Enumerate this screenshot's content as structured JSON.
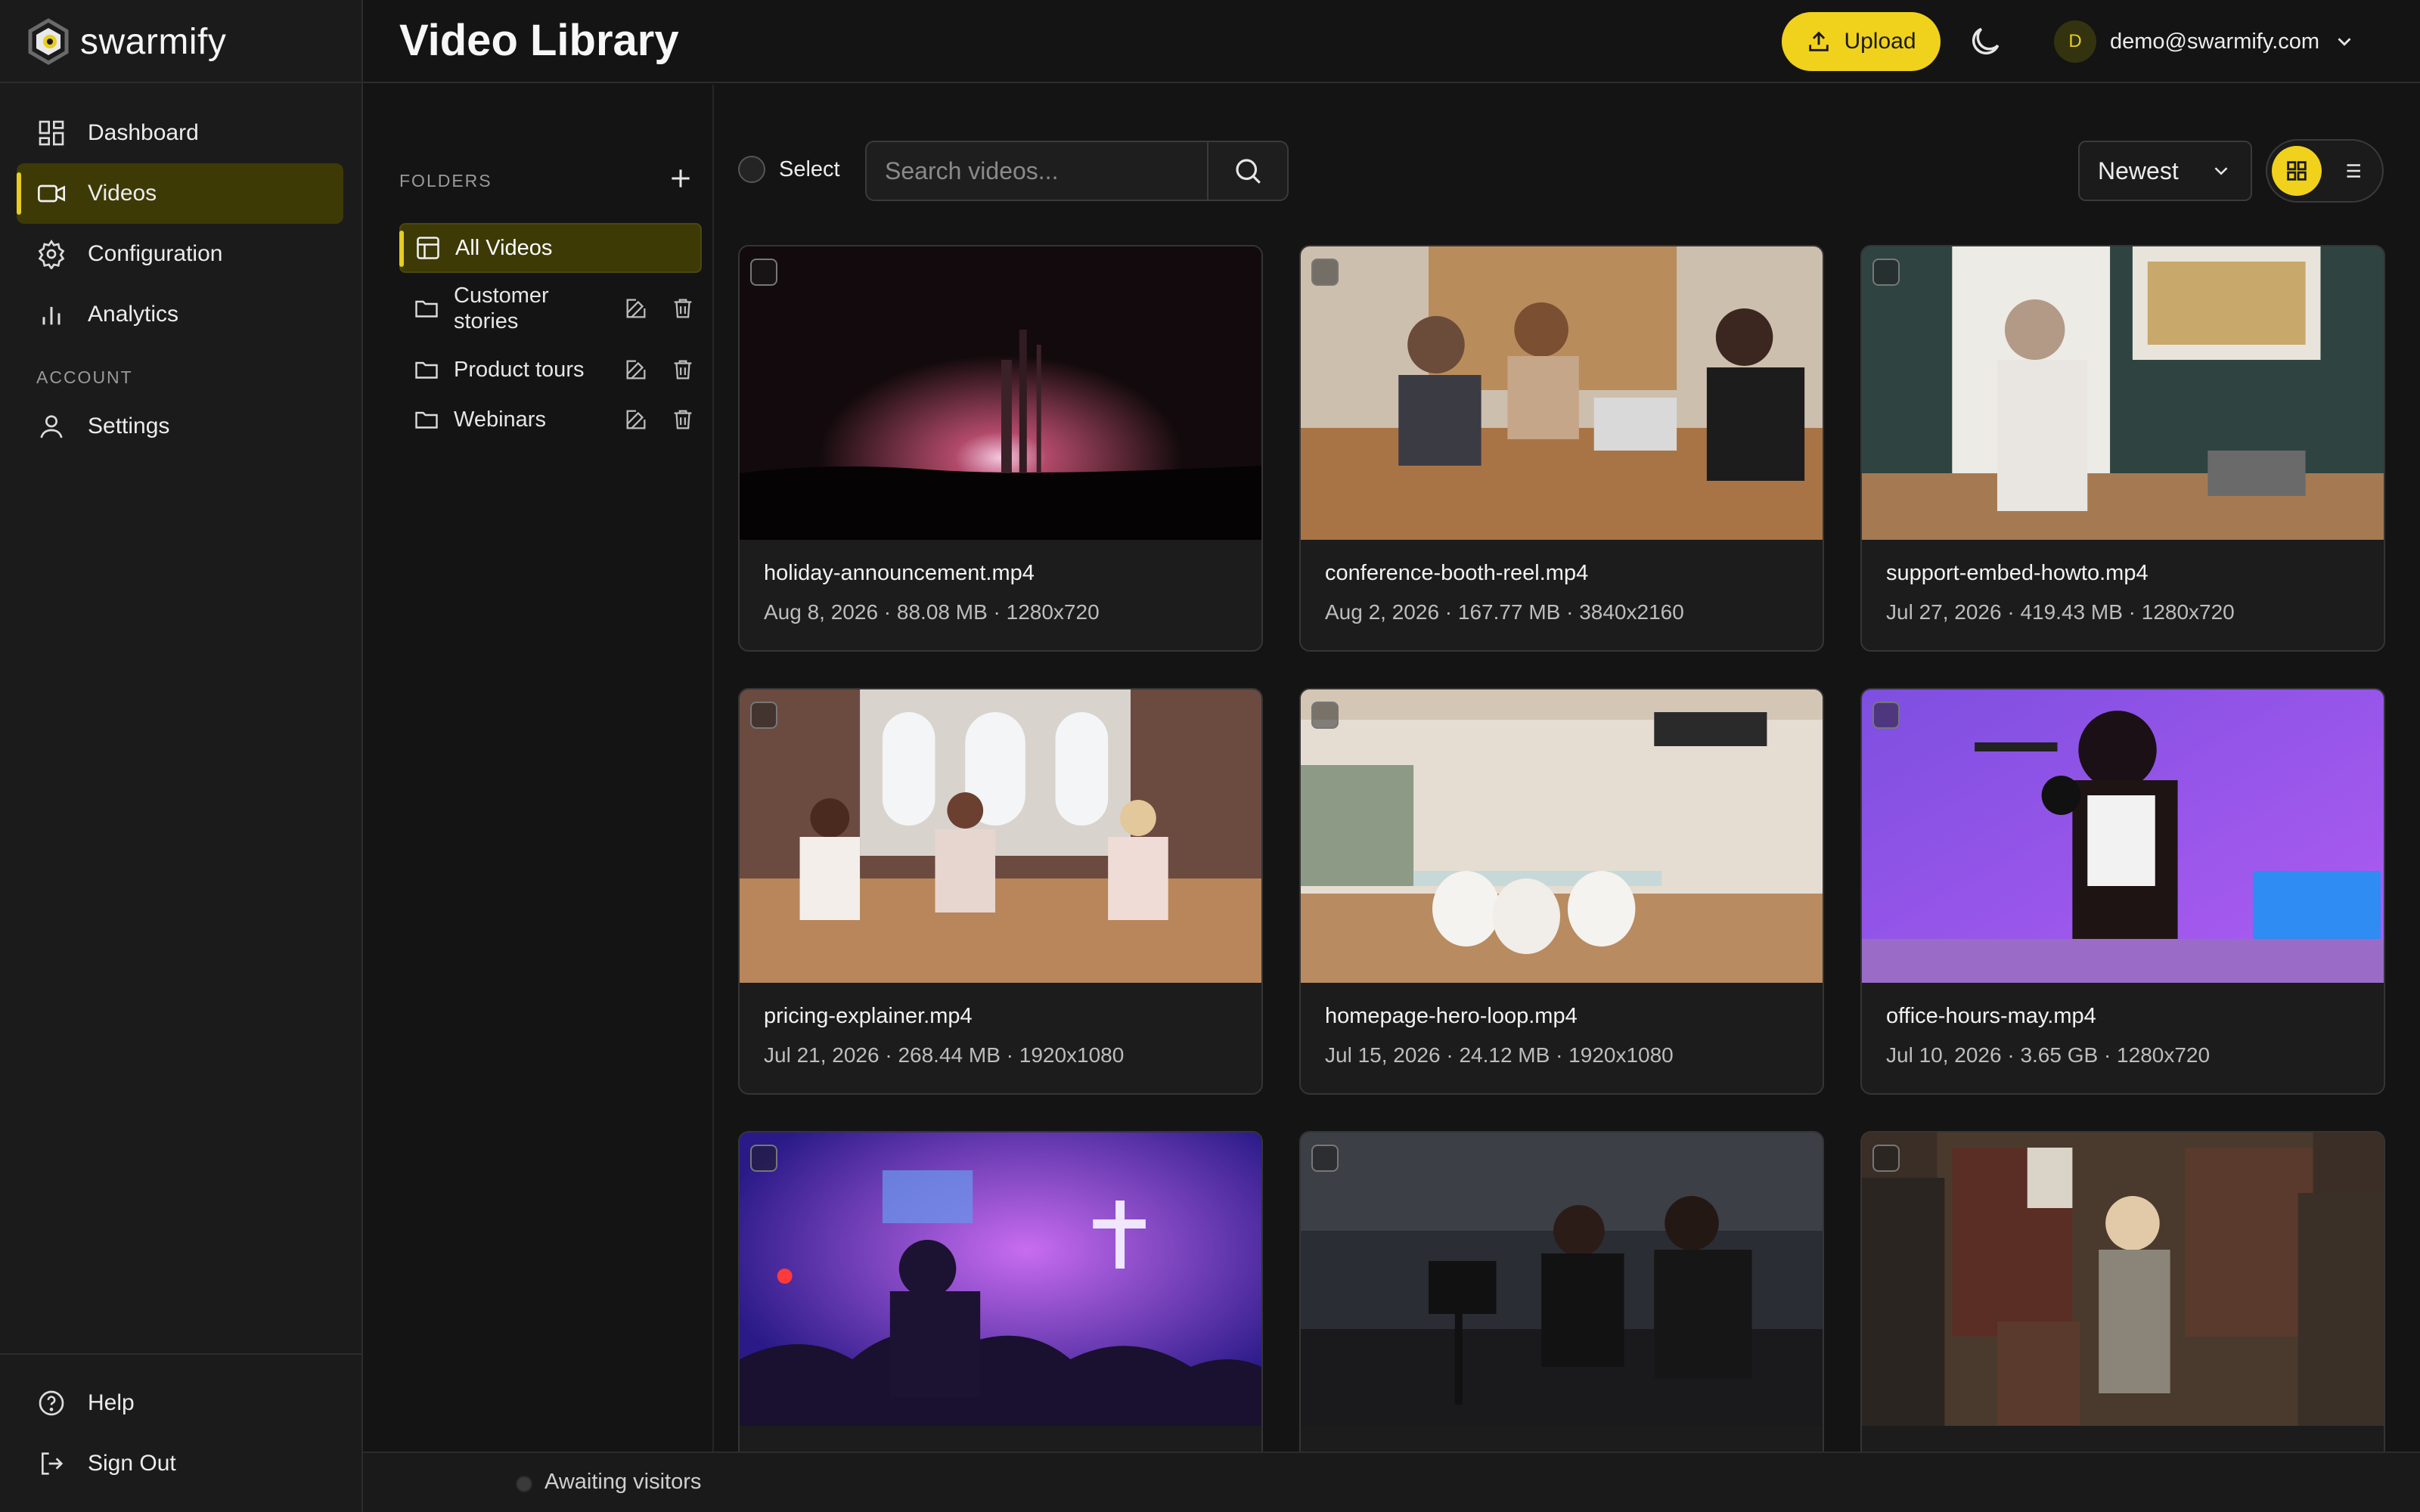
{
  "app": {
    "logo_text": "swarmify"
  },
  "sidebar": {
    "nav": [
      {
        "label": "Dashboard",
        "icon": "dashboard-icon"
      },
      {
        "label": "Videos",
        "icon": "video-icon",
        "active": true
      },
      {
        "label": "Configuration",
        "icon": "gear-icon"
      },
      {
        "label": "Analytics",
        "icon": "bar-chart-icon"
      }
    ],
    "account_label": "ACCOUNT",
    "account_items": [
      {
        "label": "Settings",
        "icon": "user-icon"
      }
    ],
    "bottom_items": [
      {
        "label": "Help",
        "icon": "help-icon"
      },
      {
        "label": "Sign Out",
        "icon": "sign-out-icon"
      }
    ]
  },
  "header": {
    "title": "Video Library",
    "upload_label": "Upload",
    "user": {
      "initial": "D",
      "email": "demo@swarmify.com"
    }
  },
  "folders": {
    "label": "FOLDERS",
    "items": [
      {
        "name": "All Videos",
        "active": true
      },
      {
        "name": "Customer stories"
      },
      {
        "name": "Product tours"
      },
      {
        "name": "Webinars"
      }
    ]
  },
  "toolbar": {
    "select_label": "Select",
    "search_placeholder": "Search videos...",
    "sort_value": "Newest",
    "view_mode": "grid"
  },
  "videos": [
    {
      "title": "holiday-announcement.mp4",
      "meta": "Aug 8, 2026 · 88.08 MB · 1280x720"
    },
    {
      "title": "conference-booth-reel.mp4",
      "meta": "Aug 2, 2026 · 167.77 MB · 3840x2160"
    },
    {
      "title": "support-embed-howto.mp4",
      "meta": "Jul 27, 2026 · 419.43 MB · 1280x720"
    },
    {
      "title": "pricing-explainer.mp4",
      "meta": "Jul 21, 2026 · 268.44 MB · 1920x1080"
    },
    {
      "title": "homepage-hero-loop.mp4",
      "meta": "Jul 15, 2026 · 24.12 MB · 1920x1080"
    },
    {
      "title": "office-hours-may.mp4",
      "meta": "Jul 10, 2026 · 3.65 GB · 1280x720"
    },
    {
      "title": "",
      "meta": ""
    },
    {
      "title": "",
      "meta": ""
    },
    {
      "title": "",
      "meta": ""
    }
  ],
  "status": {
    "text": "Awaiting visitors"
  },
  "colors": {
    "accent": "#f0d21c",
    "active_bg": "#3d3a06",
    "background": "#141414"
  }
}
